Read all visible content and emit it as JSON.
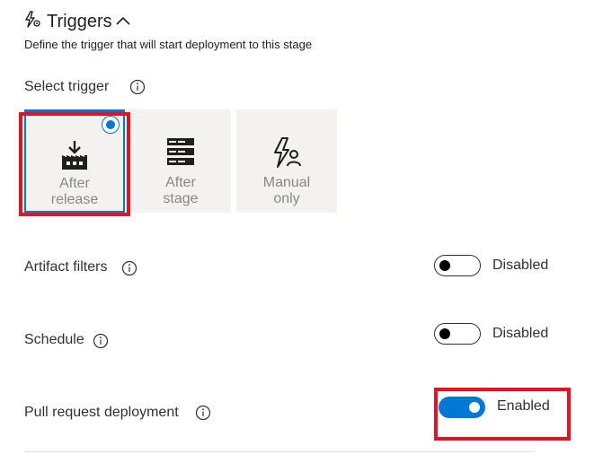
{
  "header": {
    "title": "Triggers",
    "subtitle": "Define the trigger that will start deployment to this stage"
  },
  "select_trigger": {
    "label": "Select trigger",
    "options": [
      {
        "label": "After\nrelease",
        "icon": "building-download-icon",
        "selected": true
      },
      {
        "label": "After\nstage",
        "icon": "server-stack-icon",
        "selected": false
      },
      {
        "label": "Manual\nonly",
        "icon": "lightning-person-icon",
        "selected": false
      }
    ]
  },
  "rows": {
    "artifact_filters": {
      "label": "Artifact filters",
      "status": "Disabled",
      "enabled": false
    },
    "schedule": {
      "label": "Schedule",
      "status": "Disabled",
      "enabled": false
    },
    "pull_request_deployment": {
      "label": "Pull request deployment",
      "status": "Enabled",
      "enabled": true
    }
  },
  "colors": {
    "accent": "#0078d4",
    "highlight": "#e81123",
    "tile_bg": "#f3f2f1",
    "muted_text": "#8a8886"
  }
}
